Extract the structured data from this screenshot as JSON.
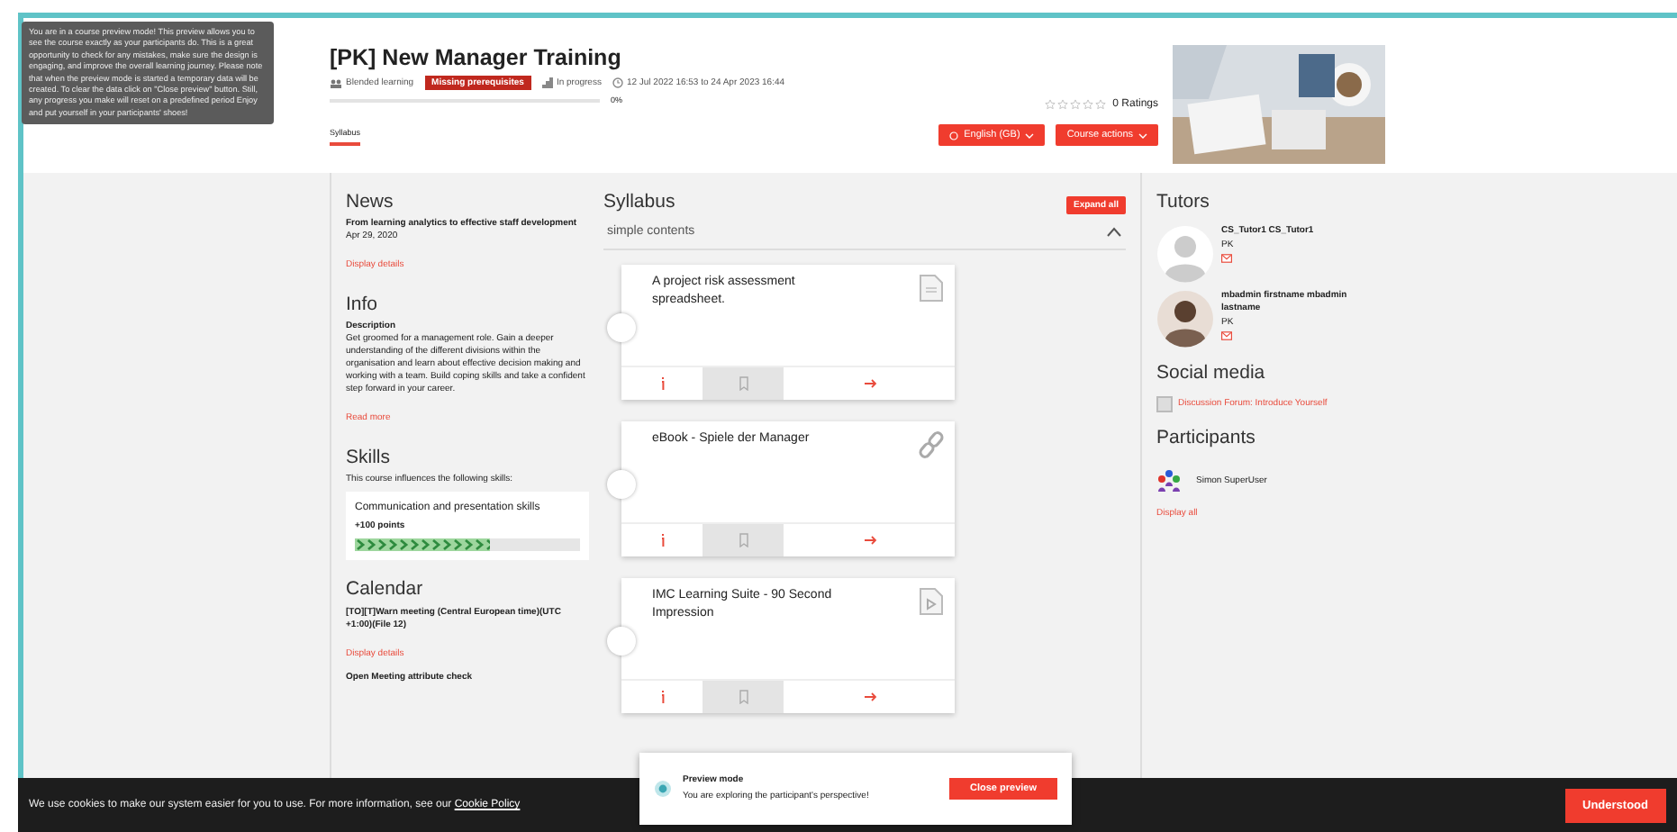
{
  "preview_tooltip": {
    "text": "You are in a course preview mode! This preview allows you to see the course exactly as your participants do. This is a great opportunity to check for any mistakes, make sure the design is engaging, and improve the overall learning journey. Please note that when the preview mode is started a temporary data will be created. To clear the data click on \"Close preview\" button. Still, any progress you make will reset on a predefined period Enjoy and put yourself in your participants' shoes!"
  },
  "course": {
    "title": "[PK] New Manager Training",
    "type_label": "Blended learning",
    "badge": "Missing prerequisites",
    "status": "In progress",
    "dates": "12 Jul 2022 16:53 to 24 Apr 2023 16:44",
    "progress": {
      "level": 0,
      "reading": "0%"
    },
    "rating": {
      "stars": 0,
      "label": "0 Ratings"
    },
    "buttons": [
      "English (GB)",
      "Course actions"
    ]
  },
  "tabs": [
    {
      "label": "Syllabus",
      "selected": true
    }
  ],
  "news": {
    "title": "News",
    "headline": "From learning analytics to effective staff development",
    "date": "Apr 29, 2020",
    "link": "Display details"
  },
  "info": {
    "title": "Info",
    "subtitle": "Description",
    "text": "Get groomed for a management role. Gain a deeper understanding of the different divisions within the organisation and learn about effective decision making and working with a team. Build coping skills and take a confident step forward in your career.",
    "link": "Read more"
  },
  "skills": {
    "title": "Skills",
    "intro": "This course influences the following skills:",
    "items": [
      {
        "name": "Communication and presentation skills",
        "points": "+100 points",
        "level": 0.6
      }
    ]
  },
  "calendar": {
    "title": "Calendar",
    "items": [
      {
        "name": "[TO][T]Warn meeting (Central European time)(UTC +1:00)(File 12)",
        "link": "Display details"
      },
      {
        "name": "Open Meeting attribute check"
      }
    ]
  },
  "syllabus": {
    "title": "Syllabus",
    "expand_button": "Expand all",
    "section": {
      "title": "simple contents",
      "expanded": true
    },
    "items": [
      {
        "title": "A project risk assessment spreadsheet.",
        "kind": "document"
      },
      {
        "title": "eBook - Spiele der Manager",
        "kind": "link"
      },
      {
        "title": "IMC Learning Suite - 90 Second Impression",
        "kind": "video"
      }
    ]
  },
  "tutors": {
    "title": "Tutors",
    "items": [
      {
        "name": "CS_Tutor1 CS_Tutor1",
        "org": "PK"
      },
      {
        "name": "mbadmin firstname mbadmin lastname",
        "org": "PK"
      }
    ]
  },
  "social_media": {
    "title": "Social media",
    "items": [
      "Discussion Forum: Introduce Yourself"
    ]
  },
  "participants": {
    "title": "Participants",
    "items": [
      "Simon SuperUser"
    ],
    "link": "Display all"
  },
  "preview_popup": {
    "title": "Preview mode",
    "text": "You are exploring the participant's perspective!",
    "button": "Close preview"
  },
  "cookie_bar": {
    "text": "We use cookies to make our system easier for you to use. For more information, see our ",
    "link": "Cookie Policy",
    "button": "Understood"
  }
}
